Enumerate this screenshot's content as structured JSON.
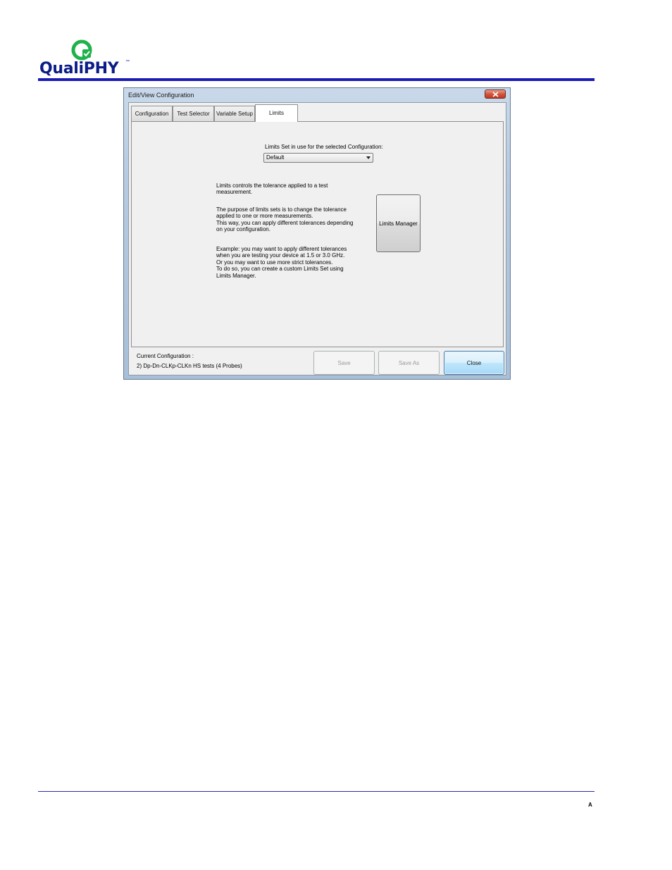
{
  "header": {
    "logo_text": "QualiPHY",
    "logo_trademark": "™",
    "footer_page": "A"
  },
  "window": {
    "title": "Edit/View Configuration",
    "tabs": [
      {
        "label": "Configuration",
        "active": false
      },
      {
        "label": "Test Selector",
        "active": false
      },
      {
        "label": "Variable Setup",
        "active": false
      },
      {
        "label": "Limits",
        "active": true
      }
    ],
    "limits": {
      "select_label": "Limits Set in use for the selected Configuration:",
      "selected_value": "Default",
      "description_1": "Limits controls the tolerance applied to a test\nmeasurement.",
      "description_2": "The purpose of limits sets is to change the tolerance\napplied to one or more measurements.\nThis way, you can apply different tolerances depending\non your configuration.",
      "description_3": "Example: you may want to apply different tolerances\nwhen you are testing your device at 1.5 or 3.0 GHz.\nOr you may want to use more strict tolerances.\nTo do so, you can create a custom Limits Set using\nLimits Manager.",
      "manager_button": "Limits Manager"
    },
    "footer": {
      "current_config_label": "Current Configuration :",
      "current_config_value": "2) Dp-Dn-CLKp-CLKn HS tests (4 Probes)",
      "save_label": "Save",
      "save_as_label": "Save As",
      "close_label": "Close"
    },
    "colors": {
      "accent_blue": "#1a1ab4",
      "logo_green": "#1fb24a",
      "close_red": "#c23a22"
    }
  }
}
